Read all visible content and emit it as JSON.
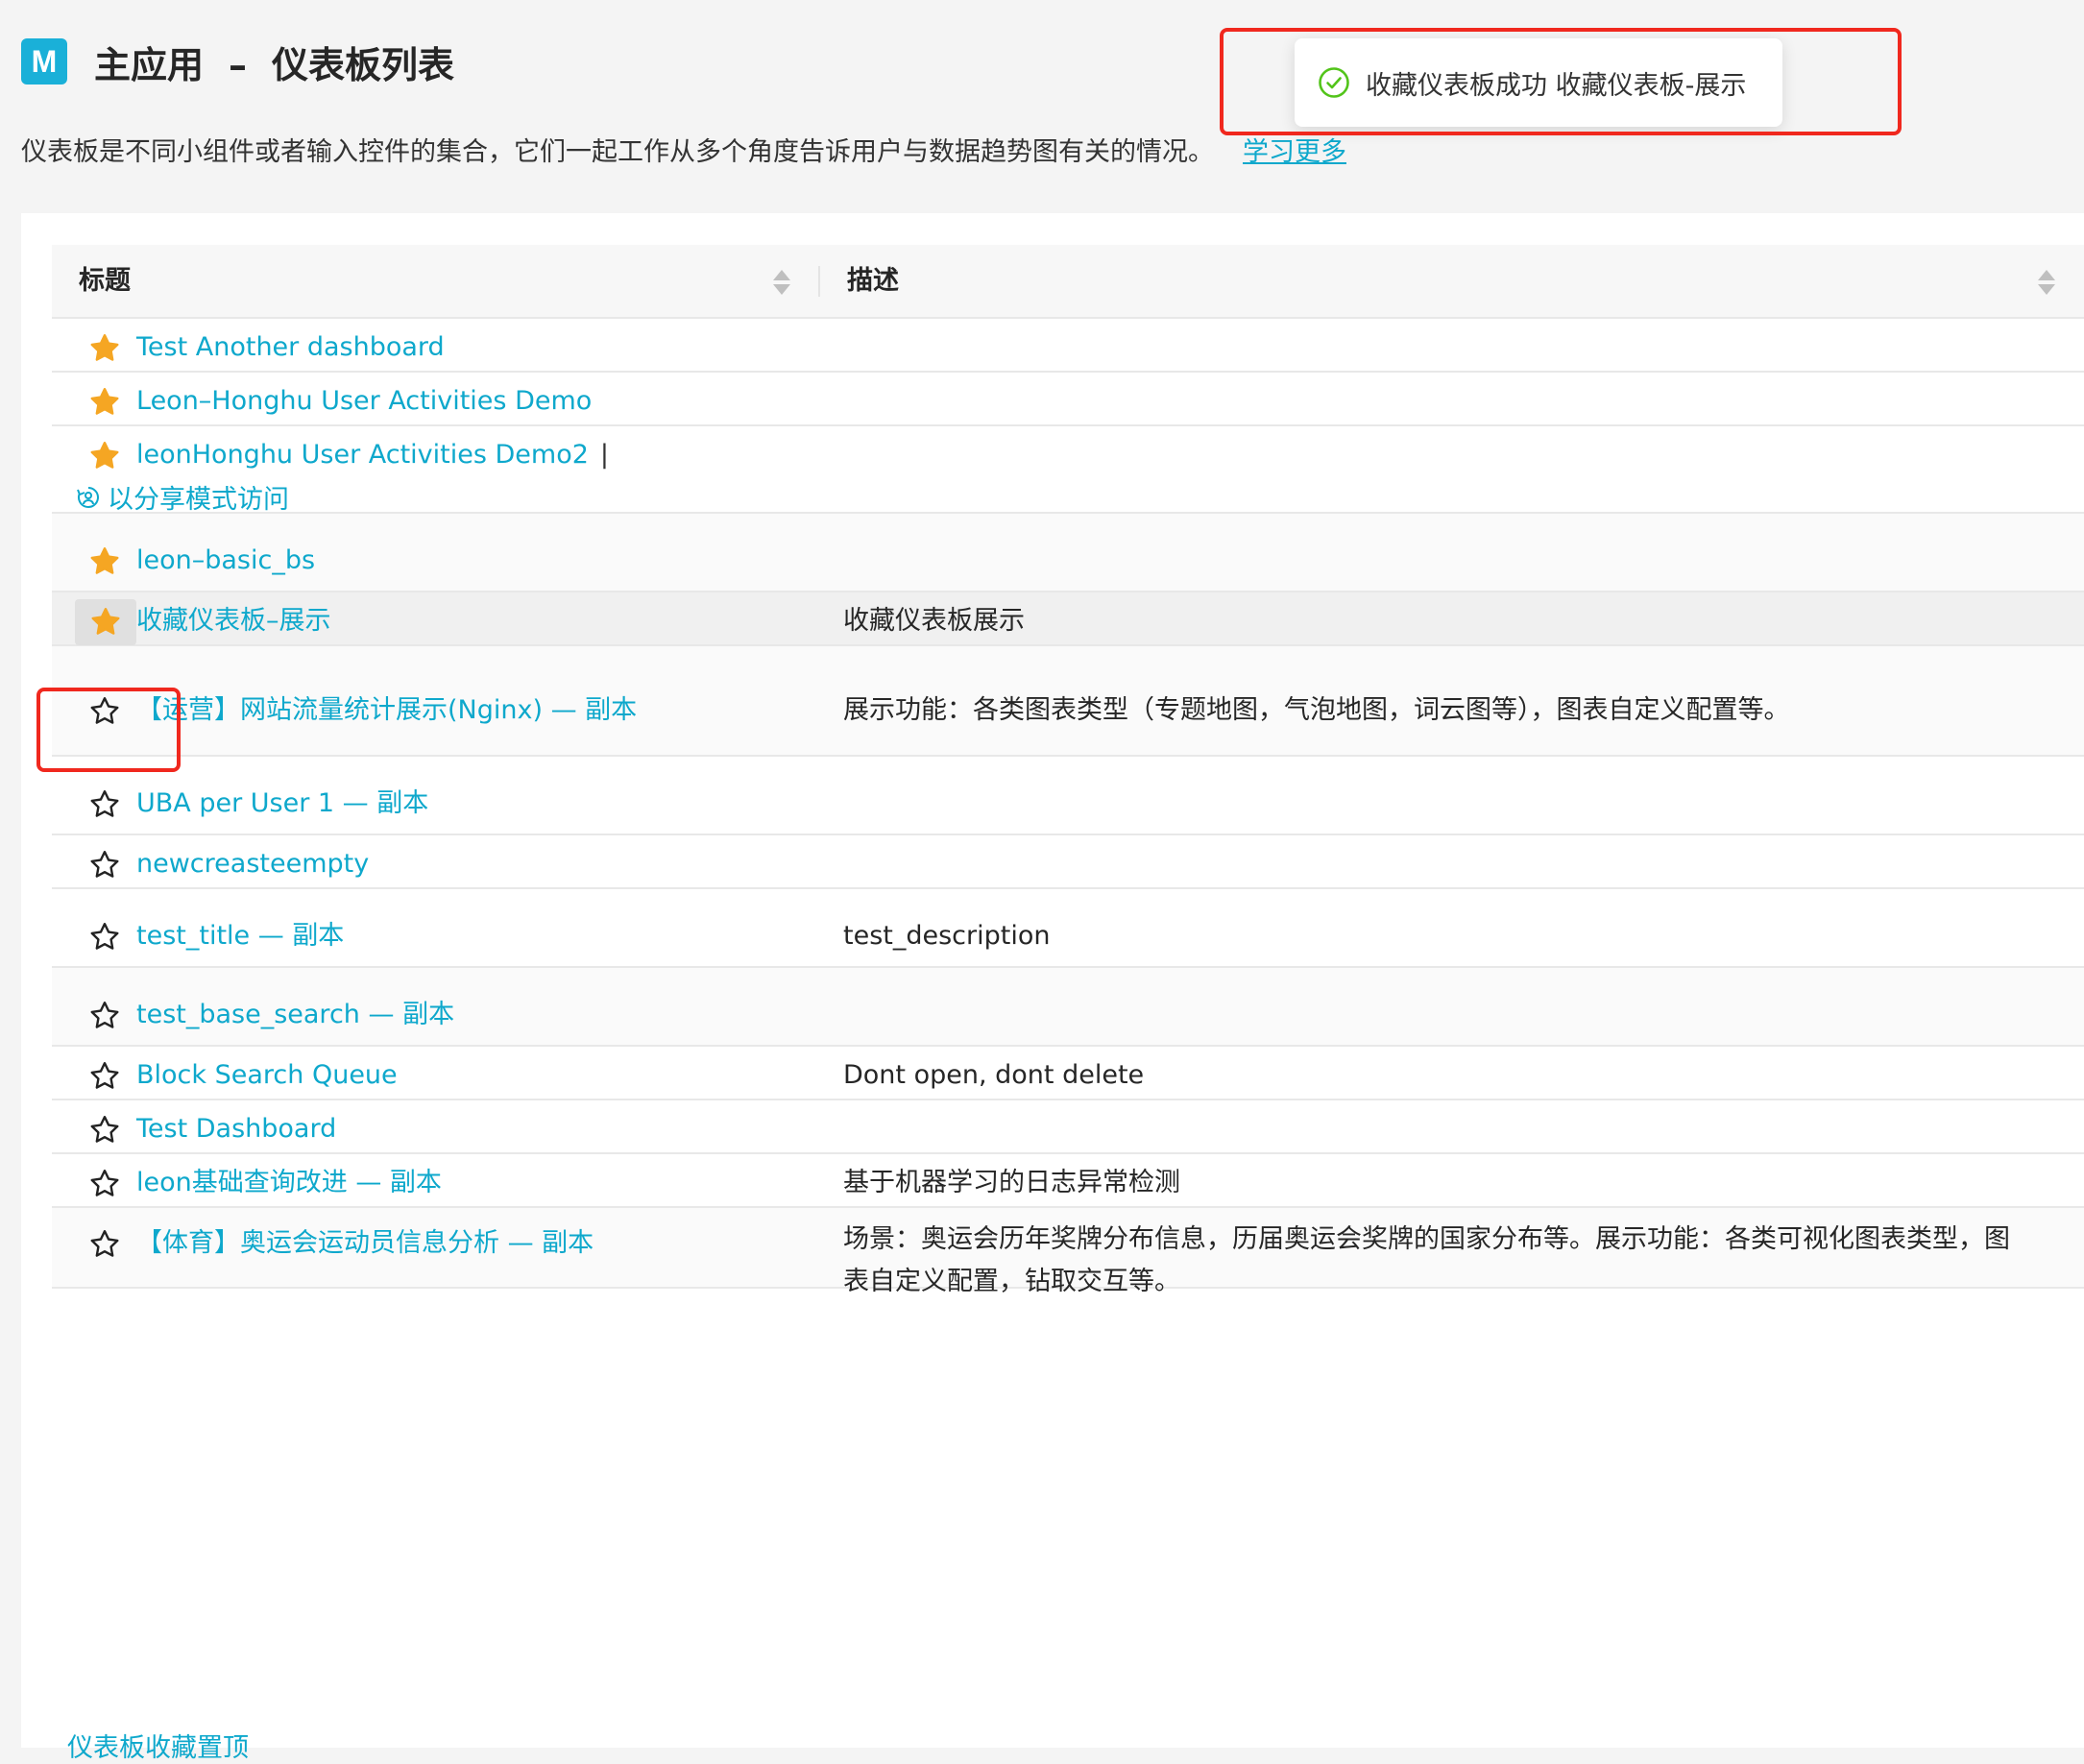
{
  "header": {
    "logo_letter": "M",
    "app_name": "主应用",
    "separator": "–",
    "page_title": "仪表板列表"
  },
  "intro": {
    "text": "仪表板是不同小组件或者输入控件的集合，它们一起工作从多个角度告诉用户与数据趋势图有关的情况。",
    "learn_more": "学习更多"
  },
  "toast": {
    "message": "收藏仪表板成功 收藏仪表板-展示"
  },
  "table": {
    "columns": [
      "标题",
      "描述"
    ],
    "rows": [
      {
        "title": "Test Another dashboard",
        "description": "",
        "starred": true
      },
      {
        "title": "Leon–Honghu User Activities Demo",
        "description": "",
        "starred": true
      },
      {
        "title": "leonHonghu User Activities Demo2",
        "description": "",
        "starred": true,
        "share_link": "以分享模式访问",
        "pipe": "|"
      },
      {
        "title": "leon–basic_bs",
        "description": "",
        "starred": true
      },
      {
        "title": "收藏仪表板–展示",
        "description": "收藏仪表板展示",
        "starred": true
      },
      {
        "title": "【运营】网站流量统计展示(Nginx) — 副本",
        "description": "展示功能：各类图表类型（专题地图，气泡地图，词云图等），图表自定义配置等。",
        "starred": false
      },
      {
        "title": "UBA per User 1 — 副本",
        "description": "",
        "starred": false
      },
      {
        "title": "newcreasteempty",
        "description": "",
        "starred": false
      },
      {
        "title": "test_title — 副本",
        "description": "test_description",
        "starred": false
      },
      {
        "title": "test_base_search — 副本",
        "description": "",
        "starred": false
      },
      {
        "title": "Block Search Queue",
        "description": "Dont open, dont delete",
        "starred": false
      },
      {
        "title": "Test Dashboard",
        "description": "",
        "starred": false
      },
      {
        "title": "leon基础查询改进 — 副本",
        "description": "基于机器学习的日志异常检测",
        "starred": false
      },
      {
        "title": "【体育】奥运会运动员信息分析 — 副本",
        "description": "场景：奥运会历年奖牌分布信息，历届奥运会奖牌的国家分布等。展示功能：各类可视化图表类型，图",
        "description2": "表自定义配置，钻取交互等。",
        "starred": false
      }
    ]
  },
  "footer": {
    "partial_item": "仪表板收藏置顶"
  },
  "colors": {
    "accent": "#0ea8cc",
    "star_filled": "#f5a623",
    "success": "#52c41a",
    "annotation": "#f0281e"
  },
  "icons": {
    "star_filled": "star-filled-icon",
    "star_outline": "star-outline-icon",
    "success": "check-circle-icon",
    "share": "share-icon"
  }
}
